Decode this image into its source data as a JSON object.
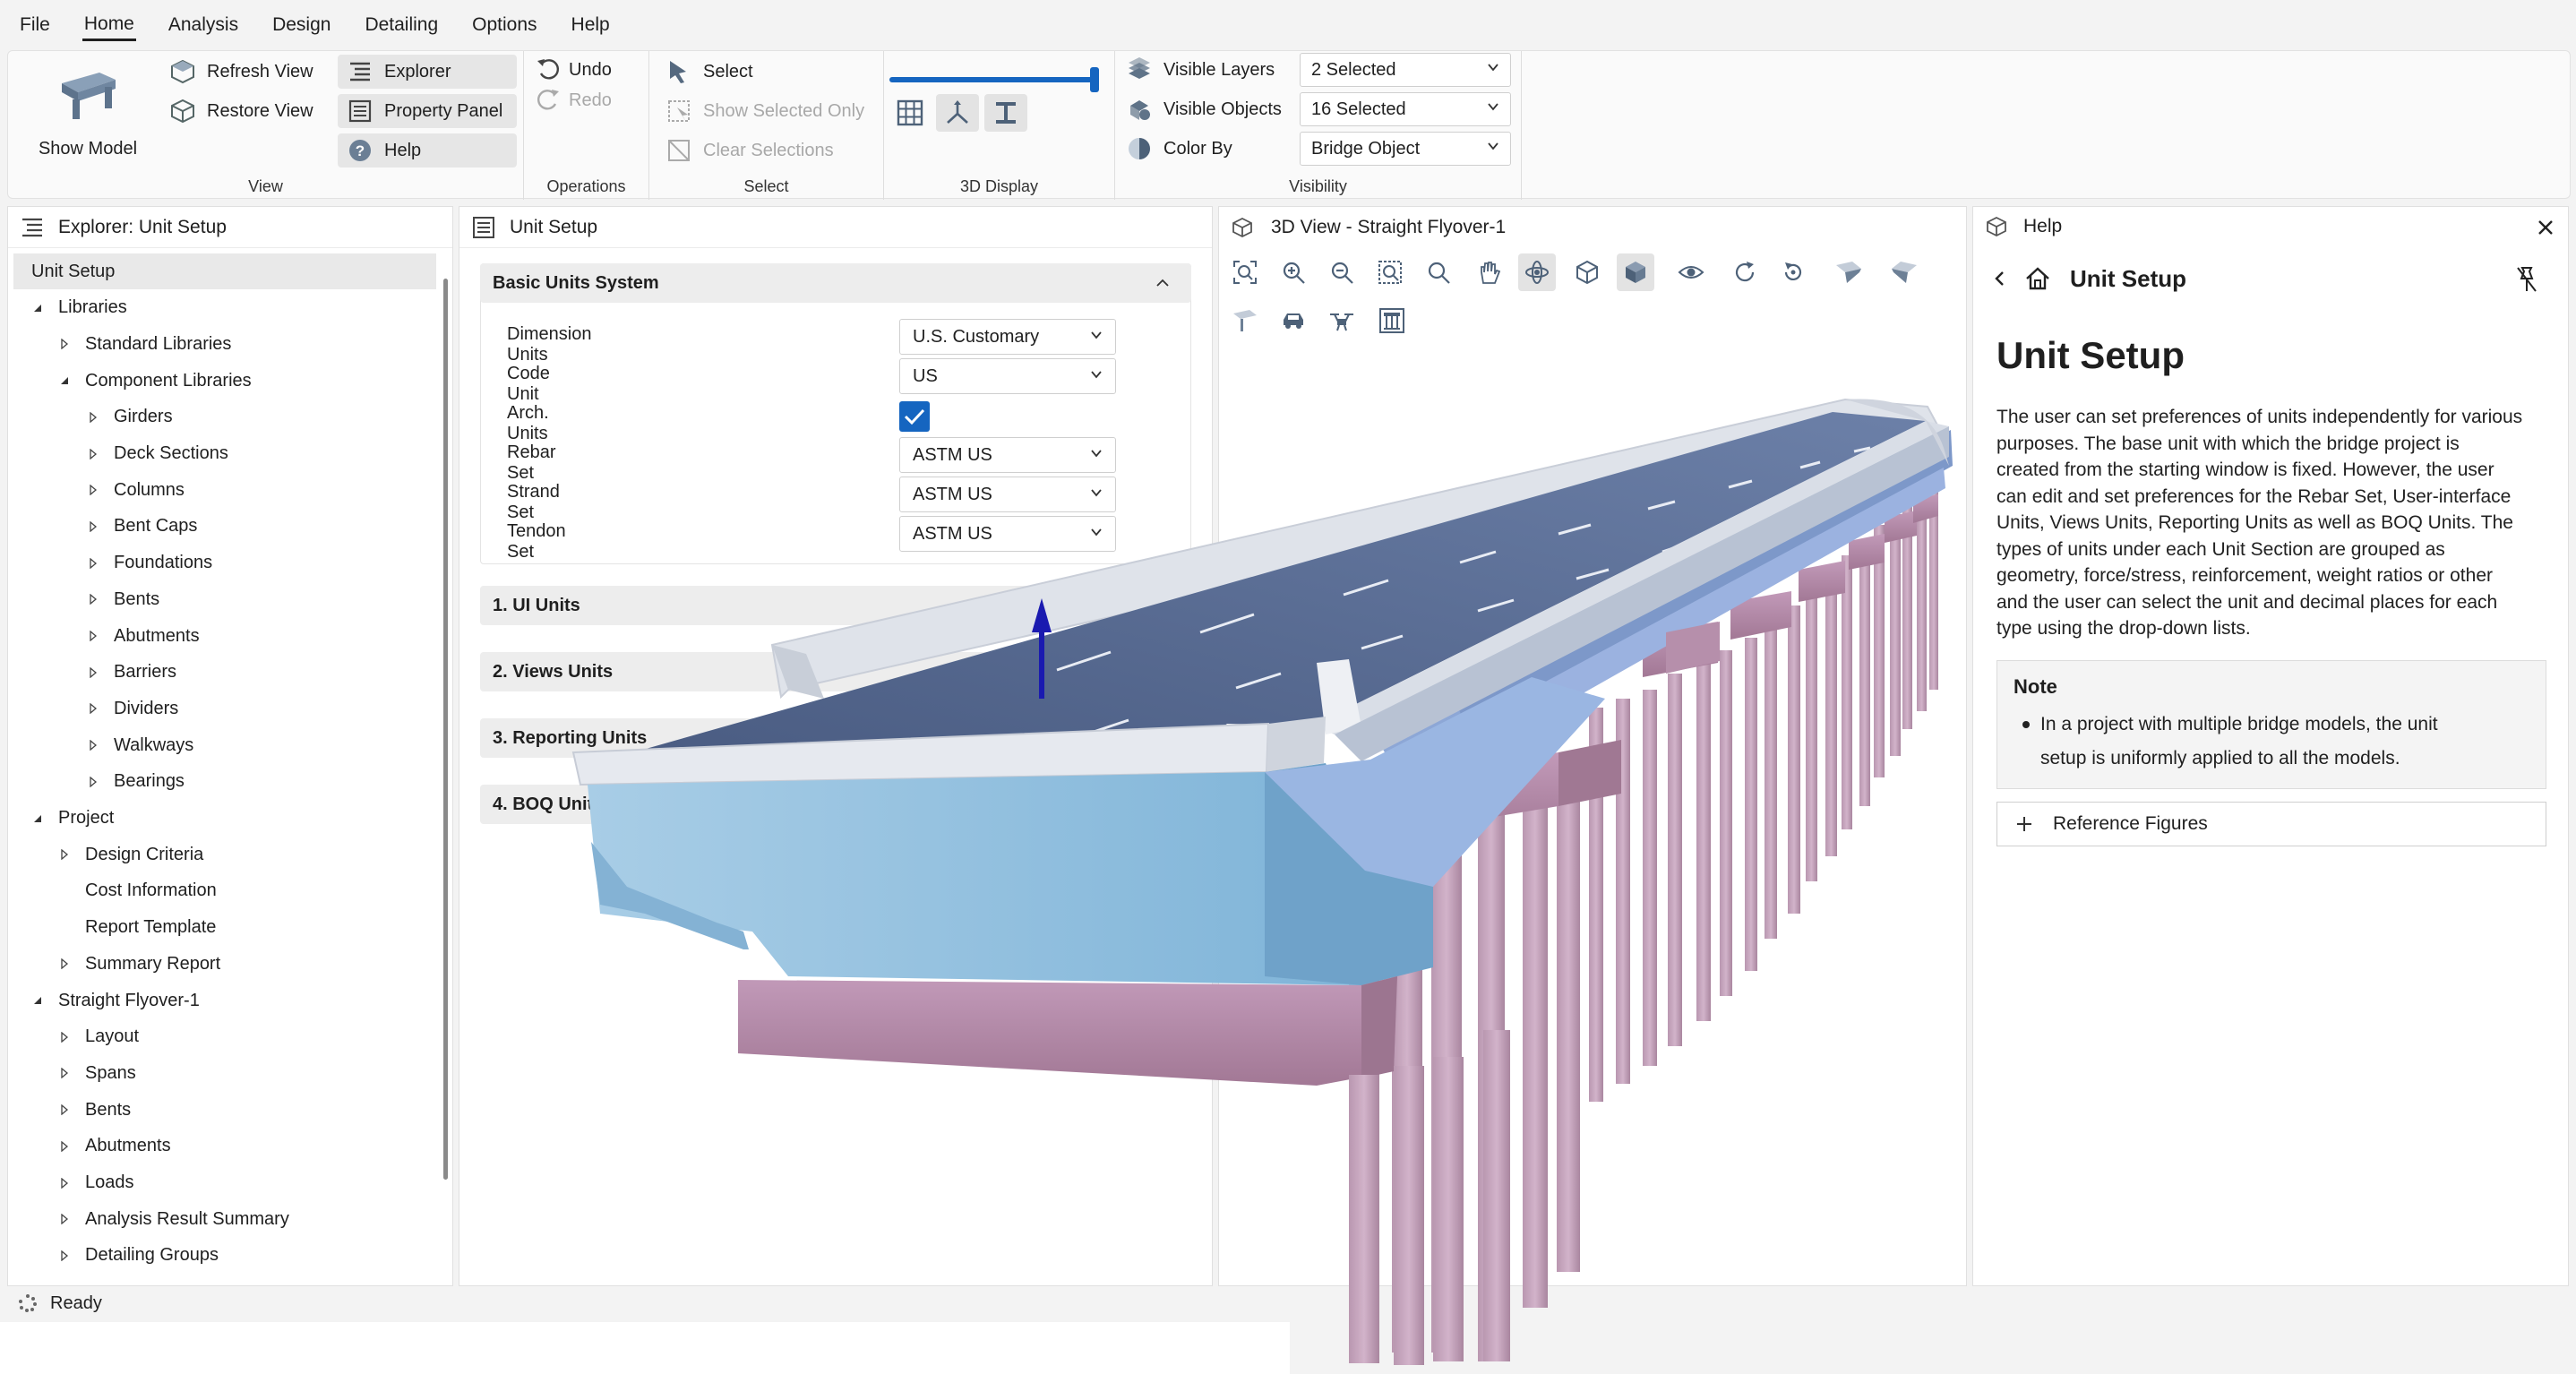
{
  "menu": [
    "File",
    "Home",
    "Analysis",
    "Design",
    "Detailing",
    "Options",
    "Help"
  ],
  "menu_active": "Home",
  "ribbon": {
    "view": {
      "label": "View",
      "show_model": "Show Model",
      "refresh_view": "Refresh View",
      "restore_view": "Restore View",
      "explorer": "Explorer",
      "property_panel": "Property Panel",
      "help": "Help"
    },
    "operations": {
      "label": "Operations",
      "undo": "Undo",
      "redo": "Redo"
    },
    "select": {
      "label": "Select",
      "select": "Select",
      "show_selected_only": "Show Selected Only",
      "clear_selections": "Clear Selections"
    },
    "display3d": {
      "label": "3D Display",
      "slider_level": 1.0
    },
    "visibility": {
      "label": "Visibility",
      "visible_layers": "Visible Layers",
      "visible_layers_value": "2 Selected",
      "visible_objects": "Visible Objects",
      "visible_objects_value": "16 Selected",
      "color_by": "Color By",
      "color_by_value": "Bridge Object"
    }
  },
  "explorer": {
    "title": "Explorer: Unit Setup",
    "items": [
      {
        "label": "Unit Setup",
        "level": 0,
        "exp": "none",
        "selected": true
      },
      {
        "label": "Libraries",
        "level": 0,
        "exp": "open"
      },
      {
        "label": "Standard Libraries",
        "level": 1,
        "exp": "closed"
      },
      {
        "label": "Component Libraries",
        "level": 1,
        "exp": "open"
      },
      {
        "label": "Girders",
        "level": 2,
        "exp": "closed"
      },
      {
        "label": "Deck Sections",
        "level": 2,
        "exp": "closed"
      },
      {
        "label": "Columns",
        "level": 2,
        "exp": "closed"
      },
      {
        "label": "Bent Caps",
        "level": 2,
        "exp": "closed"
      },
      {
        "label": "Foundations",
        "level": 2,
        "exp": "closed"
      },
      {
        "label": "Bents",
        "level": 2,
        "exp": "closed"
      },
      {
        "label": "Abutments",
        "level": 2,
        "exp": "closed"
      },
      {
        "label": "Barriers",
        "level": 2,
        "exp": "closed"
      },
      {
        "label": "Dividers",
        "level": 2,
        "exp": "closed"
      },
      {
        "label": "Walkways",
        "level": 2,
        "exp": "closed"
      },
      {
        "label": "Bearings",
        "level": 2,
        "exp": "closed"
      },
      {
        "label": "Project",
        "level": 0,
        "exp": "open"
      },
      {
        "label": "Design Criteria",
        "level": 1,
        "exp": "closed"
      },
      {
        "label": "Cost Information",
        "level": 1,
        "exp": "none"
      },
      {
        "label": "Report Template",
        "level": 1,
        "exp": "none"
      },
      {
        "label": "Summary Report",
        "level": 1,
        "exp": "closed"
      },
      {
        "label": "Straight Flyover-1",
        "level": 0,
        "exp": "open"
      },
      {
        "label": "Layout",
        "level": 1,
        "exp": "closed"
      },
      {
        "label": "Spans",
        "level": 1,
        "exp": "closed"
      },
      {
        "label": "Bents",
        "level": 1,
        "exp": "closed"
      },
      {
        "label": "Abutments",
        "level": 1,
        "exp": "closed"
      },
      {
        "label": "Loads",
        "level": 1,
        "exp": "closed"
      },
      {
        "label": "Analysis Result Summary",
        "level": 1,
        "exp": "closed"
      },
      {
        "label": "Detailing Groups",
        "level": 1,
        "exp": "closed"
      }
    ]
  },
  "unit_setup": {
    "title": "Unit Setup",
    "basic_units_title": "Basic Units System",
    "fields": [
      {
        "label": "Dimension Units",
        "value": "U.S. Customary",
        "type": "select"
      },
      {
        "label": "Code Unit",
        "value": "US",
        "type": "select"
      },
      {
        "label": "Arch. Units",
        "value": "",
        "type": "checkbox",
        "checked": true
      },
      {
        "label": "Rebar Set",
        "value": "ASTM US",
        "type": "select"
      },
      {
        "label": "Strand Set",
        "value": "ASTM US",
        "type": "select"
      },
      {
        "label": "Tendon Set",
        "value": "ASTM US",
        "type": "select"
      }
    ],
    "sections": [
      "1. UI Units",
      "2. Views Units",
      "3. Reporting Units",
      "4. BOQ Units"
    ]
  },
  "view3d": {
    "title": "3D View - Straight Flyover-1"
  },
  "help": {
    "panel_title": "Help",
    "nav_title": "Unit Setup",
    "heading": "Unit Setup",
    "body_lines": [
      "The user can set preferences of units independently for various",
      "purposes. The base unit with which the bridge project is",
      "created from the starting window is fixed. However, the user",
      "can edit and set preferences for the Rebar Set, User-interface",
      "Units, Views Units, Reporting Units as well as BOQ Units. The",
      "types of units under each Unit Section are grouped as",
      "geometry, force/stress, reinforcement, weight ratios or other",
      "and the user can select the unit and decimal places for each",
      "type using the drop-down lists."
    ],
    "note_title": "Note",
    "note_lines": [
      "In a project with multiple bridge models, the unit",
      "setup is uniformly applied to all the models."
    ],
    "reference_figures": "Reference Figures"
  },
  "status": {
    "text": "Ready"
  },
  "colors": {
    "accent": "#1565c0",
    "deck": "#5b6e96",
    "girder": "#8fbfdd",
    "pier": "#b98aa8",
    "barrier": "#dfe3ea"
  }
}
